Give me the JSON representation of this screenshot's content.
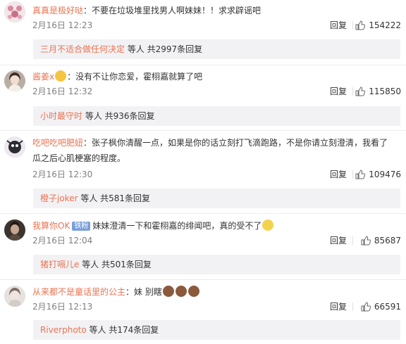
{
  "comments": [
    {
      "username": "真真是极好哒",
      "text": "：不要在垃圾堆里找男人啊妹妹！！求求辟谣吧",
      "date": "2月16日 12:23",
      "reply_label": "回复",
      "likes": "154222",
      "sub": {
        "user": "三月不适合做任何决定",
        "summary": " 等人 共2997条回复"
      }
    },
    {
      "username": "酱姜x",
      "text": "：没有不让你恋爱，霍栩嘉就算了吧",
      "date": "2月16日 12:32",
      "reply_label": "回复",
      "likes": "115850",
      "sub": {
        "user": "小时最守时",
        "summary": " 等人 共936条回复"
      }
    },
    {
      "username": "吃吧吃吧肥妞",
      "text_line1": "：张子枫你清醒一点，如果是你的话立刻打飞滴跑路，不是你请立刻澄清，我看了",
      "text_line2": "瓜之后心肌梗塞的程度。",
      "date": "2月16日 12:30",
      "reply_label": "回复",
      "likes": "109476",
      "sub": {
        "user": "橙子joker",
        "summary": " 等人 共581条回复"
      }
    },
    {
      "username": "我算你OK",
      "badge": "铁粉",
      "text": "妹妹澄清一下和霍栩嘉的绯闻吧，真的受不了",
      "date": "2月16日 12:04",
      "reply_label": "回复",
      "likes": "85687",
      "sub": {
        "user": "猪打嗝儿e",
        "summary": " 等人 共501条回复"
      }
    },
    {
      "username": "从来都不是童话里的公主",
      "text": "：妹 别瞎",
      "date": "2月16日 12:13",
      "reply_label": "回复",
      "likes": "66591",
      "sub": {
        "user": "Riverphoto",
        "summary": " 等人 共174条回复"
      }
    }
  ],
  "colors": {
    "username": "#eb7350",
    "meta": "#808080",
    "sub_bg": "#f2f2f5"
  },
  "icons": [
    "thumbs-up-icon",
    "avatar",
    "emoji"
  ]
}
